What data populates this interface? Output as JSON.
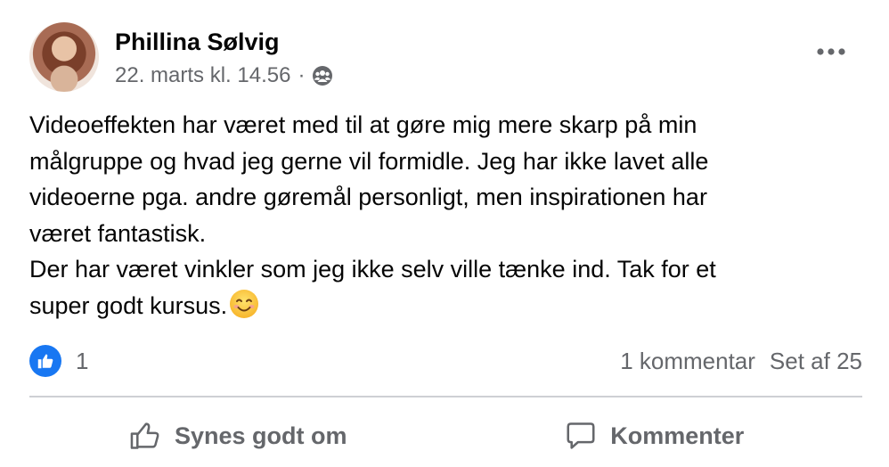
{
  "post": {
    "author": "Phillina Sølvig",
    "timestamp": "22. marts kl. 14.56",
    "separator": "·",
    "audience_icon": "friends-icon",
    "more_icon": "more-horizontal-icon",
    "text": "Videoeffekten har været med til at gøre mig mere skarp på min\nmålgruppe og hvad jeg gerne vil formidle. Jeg har ikke lavet alle\nvideoerne pga. andre gøremål personligt, men inspirationen har\nværet fantastisk.\nDer har været vinkler som jeg ikke selv ville tænke ind. Tak for et\nsuper godt kursus.",
    "emoji": "smiling-face-icon"
  },
  "stats": {
    "reaction_icon": "like-reaction-icon",
    "like_count": "1",
    "comments": "1 kommentar",
    "views": "Set af 25"
  },
  "actions": {
    "like_label": "Synes godt om",
    "comment_label": "Kommenter"
  },
  "colors": {
    "accent": "#1877f2",
    "secondary_text": "#65676b",
    "divider": "#ced0d4"
  }
}
